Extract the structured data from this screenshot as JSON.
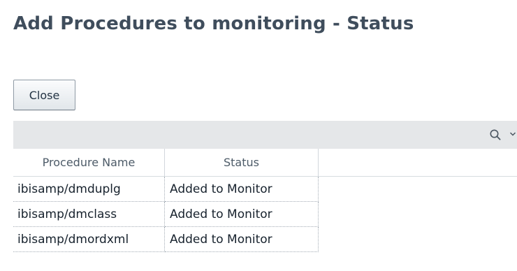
{
  "page": {
    "title": "Add Procedures to monitoring - Status"
  },
  "actions": {
    "close_label": "Close"
  },
  "toolbar": {
    "icons": [
      "search-icon",
      "chevron-down-icon"
    ]
  },
  "table": {
    "columns": [
      "Procedure Name",
      "Status"
    ],
    "rows": [
      {
        "procedure": "ibisamp/dmduplg",
        "status": "Added to Monitor"
      },
      {
        "procedure": "ibisamp/dmclass",
        "status": "Added to Monitor"
      },
      {
        "procedure": "ibisamp/dmordxml",
        "status": "Added to Monitor"
      }
    ]
  },
  "colors": {
    "title": "#3f4d5c",
    "toolbar_bg": "#e5e7e9",
    "grid_line": "#a4acb5"
  }
}
